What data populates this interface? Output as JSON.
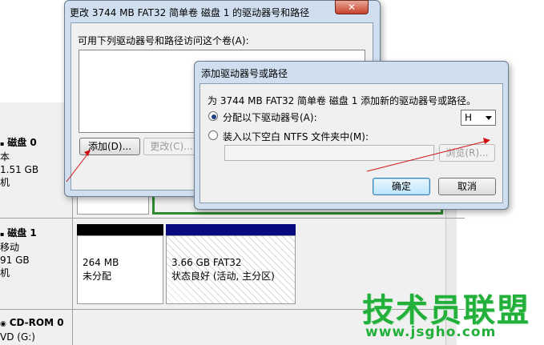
{
  "disk_management": {
    "disk0": {
      "name": "磁盘 0",
      "type": "本",
      "size": "1.51 GB",
      "status": "机"
    },
    "disk1": {
      "name": "磁盘 1",
      "type": "移动",
      "size": "91 GB",
      "status": "机",
      "partitions": [
        {
          "size": "264 MB",
          "status": "未分配"
        },
        {
          "size": "3.66 GB FAT32",
          "status": "状态良好 (活动, 主分区)"
        }
      ]
    },
    "cdrom0": {
      "name": "CD-ROM 0",
      "drive": "VD (G:)"
    }
  },
  "dialog_main": {
    "title": "更改 3744 MB FAT32 简单卷 磁盘 1 的驱动器号和路径",
    "close_label": "✕",
    "list_label": "可用下列驱动器号和路径访问这个卷(A):",
    "add_label": "添加(D)...",
    "change_label": "更改(C)..."
  },
  "dialog_add": {
    "title": "添加驱动器号或路径",
    "description": "为 3744 MB FAT32 简单卷 磁盘 1 添加新的驱动器号或路径。",
    "option_assign": "分配以下驱动器号(A):",
    "drive_letter": "H",
    "option_mount": "装入以下空白 NTFS 文件夹中(M):",
    "browse_label": "浏览(R)...",
    "ok_label": "确定",
    "cancel_label": "取消",
    "close_label": "✕"
  },
  "watermark": {
    "text": "技术员联盟",
    "url": "www.jsgho.com"
  },
  "colors": {
    "accent_blue": "#0a0a80",
    "annotation_red": "#d01010",
    "watermark_green": "#22b03a"
  }
}
